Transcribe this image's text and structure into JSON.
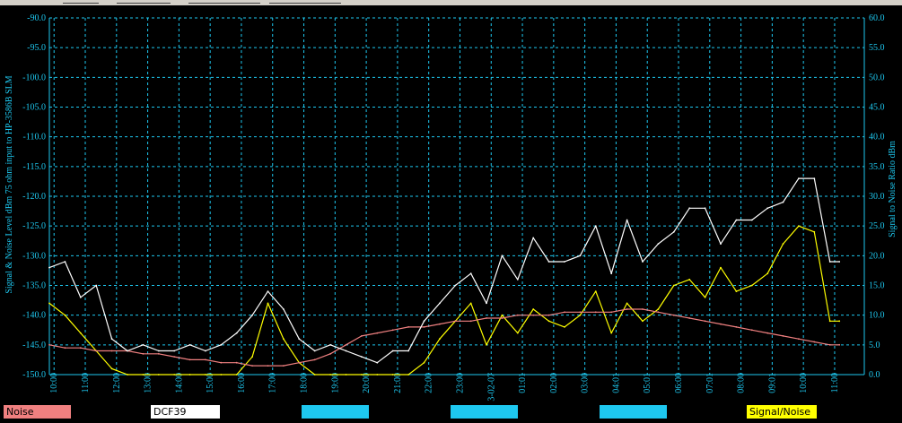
{
  "window": {
    "title": ""
  },
  "legend": {
    "items": [
      {
        "label": "Noise",
        "color": "#f08080"
      },
      {
        "label": "DCF39",
        "color": "#ffffff"
      },
      {
        "label": "",
        "color": "#1ec8f0"
      },
      {
        "label": "",
        "color": "#1ec8f0"
      },
      {
        "label": "",
        "color": "#1ec8f0"
      },
      {
        "label": "Signal/Noise",
        "color": "#ffff00"
      }
    ]
  },
  "colors": {
    "background": "#000000",
    "grid": "#1ec8f0",
    "axis_text": "#1ec8f0",
    "noise": "#f08080",
    "dcf39": "#ffffff",
    "snr": "#ffff00"
  },
  "chart_data": {
    "type": "line",
    "ylabel_left": "Signal & Noise Level  dBm 75 ohm input to HP-3586B SLM",
    "ylabel_right": "Signal to Noise Ratio  dBm",
    "ylim_left": [
      -150,
      -90
    ],
    "ylim_right": [
      0,
      60
    ],
    "yticks_left": [
      "-90.0",
      "-95.0",
      "-100.0",
      "-105.0",
      "-110.0",
      "-115.0",
      "-120.0",
      "-125.0",
      "-130.0",
      "-135.0",
      "-140.0",
      "-145.0",
      "-150.0"
    ],
    "yticks_right": [
      "60.0",
      "55.0",
      "50.0",
      "45.0",
      "40.0",
      "35.0",
      "30.0",
      "25.0",
      "20.0",
      "15.0",
      "10.0",
      "5.0",
      "0.0"
    ],
    "xticks": [
      "10:00",
      "11:00",
      "12:00",
      "13:00",
      "14:00",
      "15:00",
      "16:00",
      "17:00",
      "18:00",
      "19:00",
      "20:00",
      "21:00",
      "22:00",
      "23:00",
      "03-02-07",
      "01:01",
      "02:00",
      "03:00",
      "04:01",
      "05:01",
      "06:00",
      "07:01",
      "08:00",
      "09:01",
      "10:00",
      "11:00"
    ],
    "grid": true,
    "legend_position": "bottom",
    "x_hours": [
      0,
      0.5,
      1,
      1.5,
      2,
      2.5,
      3,
      3.5,
      4,
      4.5,
      5,
      5.5,
      6,
      6.5,
      7,
      7.5,
      8,
      8.5,
      9,
      9.5,
      10,
      10.5,
      11,
      11.5,
      12,
      12.5,
      13,
      13.5,
      14,
      14.5,
      15,
      15.5,
      16,
      16.5,
      17,
      17.5,
      18,
      18.5,
      19,
      19.5,
      20,
      20.5,
      21,
      21.5,
      22,
      22.5,
      23,
      23.5,
      24,
      24.5,
      25,
      25.3
    ],
    "series": [
      {
        "name": "Noise",
        "axis": "left",
        "values": [
          -145,
          -145.5,
          -145.5,
          -146,
          -146,
          -146,
          -146.5,
          -146.5,
          -147,
          -147.5,
          -147.5,
          -148,
          -148,
          -148.5,
          -148.5,
          -148.5,
          -148,
          -147.5,
          -146.5,
          -145,
          -143.5,
          -143,
          -142.5,
          -142,
          -142,
          -141.5,
          -141,
          -141,
          -140.5,
          -140.5,
          -140,
          -140,
          -140,
          -139.5,
          -139.5,
          -139.5,
          -139.5,
          -139,
          -139,
          -139.5,
          -140,
          -140.5,
          -141,
          -141.5,
          -142,
          -142.5,
          -143,
          -143.5,
          -144,
          -144.5,
          -145,
          -145
        ]
      },
      {
        "name": "DCF39",
        "axis": "left",
        "values": [
          -132,
          -131,
          -137,
          -135,
          -144,
          -146,
          -145,
          -146,
          -146,
          -145,
          -146,
          -145,
          -143,
          -140,
          -136,
          -139,
          -144,
          -146,
          -145,
          -146,
          -147,
          -148,
          -146,
          -146,
          -141,
          -138,
          -135,
          -133,
          -138,
          -130,
          -134,
          -127,
          -131,
          -131,
          -130,
          -125,
          -133,
          -124,
          -131,
          -128,
          -126,
          -122,
          -122,
          -128,
          -124,
          -124,
          -122,
          -121,
          -117,
          -117,
          -131,
          -131
        ]
      },
      {
        "name": "Signal/Noise",
        "axis": "right",
        "values": [
          12,
          10,
          7,
          4,
          1,
          0,
          0,
          0,
          0,
          0,
          0,
          0,
          0,
          3,
          12,
          6,
          2,
          0,
          0,
          0,
          0,
          0,
          0,
          0,
          2,
          6,
          9,
          12,
          5,
          10,
          7,
          11,
          9,
          8,
          10,
          14,
          7,
          12,
          9,
          11,
          15,
          16,
          13,
          18,
          14,
          15,
          17,
          22,
          25,
          24,
          9,
          9
        ]
      }
    ]
  }
}
